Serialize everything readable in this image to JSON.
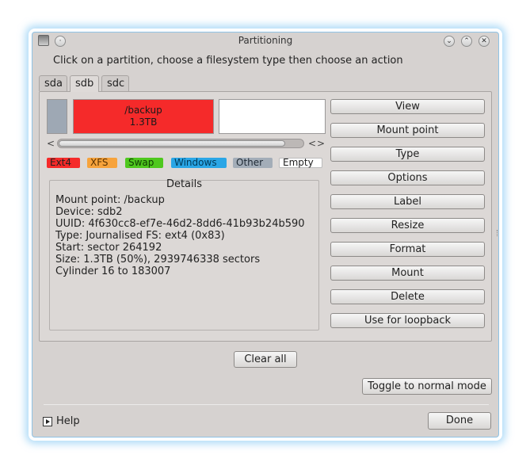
{
  "window": {
    "title": "Partitioning",
    "instruction": "Click on a partition, choose a filesystem type then choose an action"
  },
  "titlebar": {
    "icons": [
      "app-icon",
      "menu-icon",
      "chevron-down-icon",
      "chevron-up-icon",
      "close-icon"
    ]
  },
  "tabs": [
    {
      "label": "sda",
      "active": false
    },
    {
      "label": "sdb",
      "active": true
    },
    {
      "label": "sdc",
      "active": false
    }
  ],
  "partitions": {
    "selected": {
      "name": "/backup",
      "size": "1.3TB"
    },
    "colors": {
      "selected": "#f52a2a",
      "first": "#9ea8b4",
      "empty": "#ffffff"
    }
  },
  "scrollbar": {
    "position_fraction": 0.93
  },
  "legend": [
    {
      "label": "Ext4",
      "color": "#f52a2a"
    },
    {
      "label": "XFS",
      "color": "#f7a33c"
    },
    {
      "label": "Swap",
      "color": "#4fc81e"
    },
    {
      "label": "Windows",
      "color": "#2aa6e6"
    },
    {
      "label": "Other",
      "color": "#a3adb8"
    },
    {
      "label": "Empty",
      "color": "#ffffff"
    }
  ],
  "details": {
    "title": "Details",
    "lines": [
      "Mount point: /backup",
      "Device: sdb2",
      "UUID: 4f630cc8-ef7e-46d2-8dd6-41b93b24b590",
      "Type: Journalised FS: ext4 (0x83)",
      "Start: sector 264192",
      "Size: 1.3TB (50%), 2939746338 sectors",
      "Cylinder 16 to 183007"
    ]
  },
  "actions": [
    "View",
    "Mount point",
    "Type",
    "Options",
    "Label",
    "Resize",
    "Format",
    "Mount",
    "Delete",
    "Use for loopback"
  ],
  "buttons": {
    "clear_all": "Clear all",
    "toggle_mode": "Toggle to normal mode",
    "help": "Help",
    "done": "Done"
  }
}
